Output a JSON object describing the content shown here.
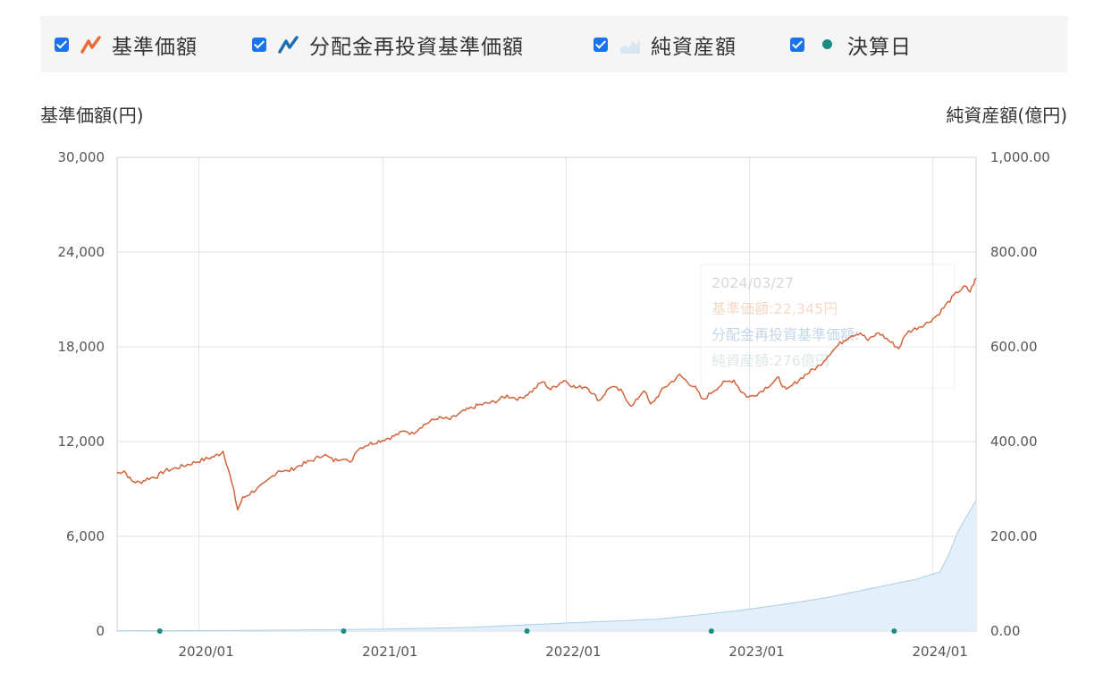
{
  "legend": {
    "items": [
      {
        "label": "基準価額",
        "checked": true,
        "icon": "orange-line-icon",
        "color": "#f06a38"
      },
      {
        "label": "分配金再投資基準価額",
        "checked": true,
        "icon": "blue-line-icon",
        "color": "#1f6fb0"
      },
      {
        "label": "純資産額",
        "checked": true,
        "icon": "area-chart-icon",
        "color": "#c9dcec"
      },
      {
        "label": "決算日",
        "checked": true,
        "icon": "dot-icon",
        "color": "#1a8c84"
      }
    ]
  },
  "axes": {
    "left_title": "基準価額(円)",
    "right_title": "純資産額(億円)"
  },
  "tooltip": {
    "date": "2024/03/27",
    "nav_label": "基準価額",
    "nav_value": "22,345円",
    "reinvest_label": "分配金再投資基準価額",
    "assets_label": "純資産額",
    "assets_value": "276"
  },
  "colors": {
    "nav_line": "#d2643c",
    "assets_fill": "#e3f0f9",
    "assets_stroke": "#a9cde9",
    "settlement_dot": "#1a8c84",
    "grid": "#dde3ea",
    "axis": "#c8d3de"
  },
  "chart_data": {
    "type": "line",
    "x_tick_labels": [
      "2020/01",
      "2021/01",
      "2022/01",
      "2023/01",
      "2024/01"
    ],
    "x_range": [
      "2019-07-22",
      "2024-03-27"
    ],
    "left_axis": {
      "range": [
        0,
        30000
      ],
      "ticks": [
        "0",
        "6,000",
        "12,000",
        "18,000",
        "24,000",
        "30,000"
      ]
    },
    "right_axis": {
      "range": [
        0,
        1000
      ],
      "ticks": [
        "0.00",
        "200.00",
        "400.00",
        "600.00",
        "800.00",
        "1,000.00"
      ]
    },
    "grid": true,
    "series": [
      {
        "name": "基準価額",
        "axis": "left",
        "points": [
          [
            "2019-07-22",
            10000
          ],
          [
            "2019-08-05",
            10150
          ],
          [
            "2019-08-20",
            9500
          ],
          [
            "2019-09-05",
            9400
          ],
          [
            "2019-09-20",
            9650
          ],
          [
            "2019-10-10",
            9800
          ],
          [
            "2019-10-25",
            10150
          ],
          [
            "2019-11-15",
            10300
          ],
          [
            "2019-12-05",
            10500
          ],
          [
            "2019-12-25",
            10700
          ],
          [
            "2020-01-15",
            10900
          ],
          [
            "2020-01-31",
            11050
          ],
          [
            "2020-02-10",
            11200
          ],
          [
            "2020-02-18",
            11400
          ],
          [
            "2020-02-28",
            10300
          ],
          [
            "2020-03-10",
            8900
          ],
          [
            "2020-03-18",
            7700
          ],
          [
            "2020-03-28",
            8400
          ],
          [
            "2020-04-15",
            8800
          ],
          [
            "2020-05-10",
            9300
          ],
          [
            "2020-06-08",
            10200
          ],
          [
            "2020-06-25",
            10100
          ],
          [
            "2020-07-20",
            10500
          ],
          [
            "2020-08-20",
            10900
          ],
          [
            "2020-09-05",
            11200
          ],
          [
            "2020-09-25",
            10800
          ],
          [
            "2020-10-15",
            11000
          ],
          [
            "2020-10-28",
            10600
          ],
          [
            "2020-11-10",
            11500
          ],
          [
            "2020-11-30",
            11800
          ],
          [
            "2020-12-31",
            12100
          ],
          [
            "2021-01-20",
            12300
          ],
          [
            "2021-02-15",
            12700
          ],
          [
            "2021-02-28",
            12500
          ],
          [
            "2021-03-20",
            13000
          ],
          [
            "2021-04-20",
            13500
          ],
          [
            "2021-05-15",
            13400
          ],
          [
            "2021-06-10",
            13900
          ],
          [
            "2021-07-10",
            14300
          ],
          [
            "2021-08-10",
            14500
          ],
          [
            "2021-09-05",
            14900
          ],
          [
            "2021-09-30",
            14700
          ],
          [
            "2021-10-25",
            15200
          ],
          [
            "2021-11-15",
            15800
          ],
          [
            "2021-12-01",
            15300
          ],
          [
            "2021-12-28",
            15900
          ],
          [
            "2022-01-20",
            15400
          ],
          [
            "2022-02-10",
            15500
          ],
          [
            "2022-03-08",
            14600
          ],
          [
            "2022-03-30",
            15500
          ],
          [
            "2022-04-20",
            15200
          ],
          [
            "2022-05-12",
            14200
          ],
          [
            "2022-06-05",
            15300
          ],
          [
            "2022-06-18",
            14300
          ],
          [
            "2022-07-15",
            15400
          ],
          [
            "2022-08-15",
            16200
          ],
          [
            "2022-08-30",
            15800
          ],
          [
            "2022-09-15",
            15400
          ],
          [
            "2022-09-30",
            14600
          ],
          [
            "2022-10-20",
            15200
          ],
          [
            "2022-11-10",
            15700
          ],
          [
            "2022-12-01",
            15900
          ],
          [
            "2022-12-15",
            15200
          ],
          [
            "2022-12-30",
            14800
          ],
          [
            "2023-01-20",
            15100
          ],
          [
            "2023-02-10",
            15600
          ],
          [
            "2023-02-28",
            16000
          ],
          [
            "2023-03-15",
            15200
          ],
          [
            "2023-04-05",
            15800
          ],
          [
            "2023-04-25",
            16300
          ],
          [
            "2023-05-20",
            16800
          ],
          [
            "2023-06-10",
            17600
          ],
          [
            "2023-06-30",
            18200
          ],
          [
            "2023-07-20",
            18700
          ],
          [
            "2023-08-10",
            18900
          ],
          [
            "2023-08-25",
            18400
          ],
          [
            "2023-09-15",
            18900
          ],
          [
            "2023-10-05",
            18400
          ],
          [
            "2023-10-25",
            17900
          ],
          [
            "2023-11-10",
            18900
          ],
          [
            "2023-11-30",
            19200
          ],
          [
            "2023-12-20",
            19500
          ],
          [
            "2024-01-10",
            20000
          ],
          [
            "2024-01-31",
            20800
          ],
          [
            "2024-02-20",
            21500
          ],
          [
            "2024-03-05",
            21800
          ],
          [
            "2024-03-15",
            21500
          ],
          [
            "2024-03-22",
            22000
          ],
          [
            "2024-03-27",
            22345
          ]
        ]
      },
      {
        "name": "純資産額",
        "axis": "right",
        "points": [
          [
            "2019-07-22",
            0.5
          ],
          [
            "2020-01-01",
            1
          ],
          [
            "2020-07-01",
            2
          ],
          [
            "2021-01-01",
            4
          ],
          [
            "2021-07-01",
            8
          ],
          [
            "2022-01-01",
            17
          ],
          [
            "2022-07-01",
            25
          ],
          [
            "2022-12-01",
            42
          ],
          [
            "2023-03-01",
            55
          ],
          [
            "2023-06-01",
            70
          ],
          [
            "2023-09-01",
            90
          ],
          [
            "2023-12-01",
            110
          ],
          [
            "2024-01-15",
            125
          ],
          [
            "2024-02-01",
            160
          ],
          [
            "2024-02-20",
            210
          ],
          [
            "2024-03-10",
            245
          ],
          [
            "2024-03-27",
            276
          ]
        ]
      }
    ],
    "settlement_dates": [
      "2019-10-15",
      "2020-10-15",
      "2021-10-15",
      "2022-10-17",
      "2023-10-16"
    ]
  }
}
